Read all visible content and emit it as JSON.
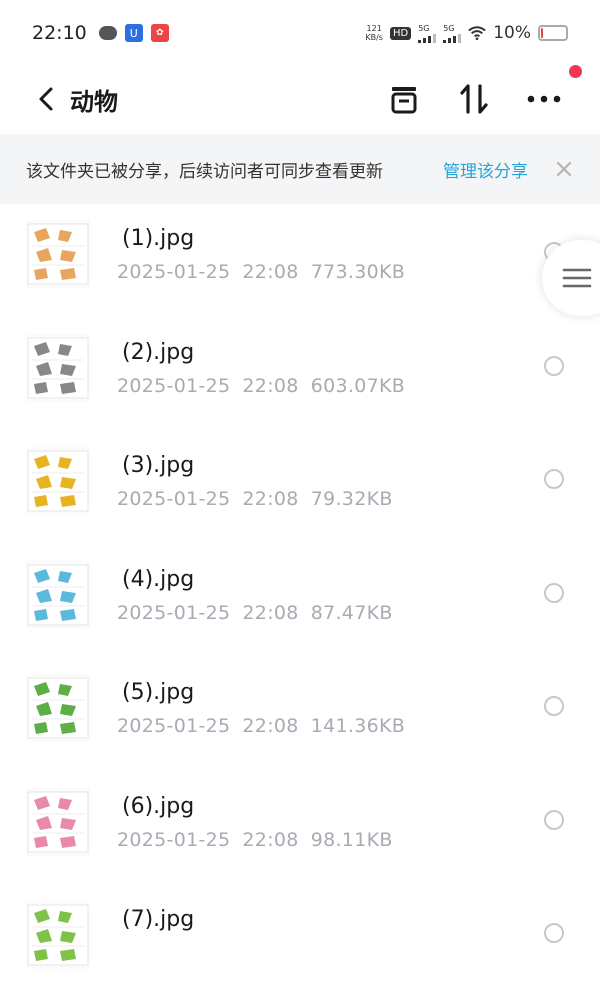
{
  "status_bar": {
    "time": "22:10",
    "net_speed_value": "121",
    "net_speed_unit": "KB/s",
    "hd_label": "HD",
    "sim1_label": "5G",
    "sim2_label": "5G",
    "battery_percent": "10%",
    "battery_level": 0.1,
    "battery_color": "#e74545"
  },
  "nav": {
    "title": "动物"
  },
  "share_banner": {
    "text": "该文件夹已被分享，后续访问者可同步查看更新",
    "manage_label": "管理该分享"
  },
  "accent_color": "#2aa3d8",
  "files": [
    {
      "name": "(1).jpg",
      "date": "2025-01-25",
      "time": "22:08",
      "size": "773.30KB",
      "thumb_color": "#e8a560"
    },
    {
      "name": "(2).jpg",
      "date": "2025-01-25",
      "time": "22:08",
      "size": "603.07KB",
      "thumb_color": "#888888"
    },
    {
      "name": "(3).jpg",
      "date": "2025-01-25",
      "time": "22:08",
      "size": "79.32KB",
      "thumb_color": "#e6b422"
    },
    {
      "name": "(4).jpg",
      "date": "2025-01-25",
      "time": "22:08",
      "size": "87.47KB",
      "thumb_color": "#5bb9db"
    },
    {
      "name": "(5).jpg",
      "date": "2025-01-25",
      "time": "22:08",
      "size": "141.36KB",
      "thumb_color": "#5cae45"
    },
    {
      "name": "(6).jpg",
      "date": "2025-01-25",
      "time": "22:08",
      "size": "98.11KB",
      "thumb_color": "#e98aa6"
    },
    {
      "name": "(7).jpg",
      "date": "",
      "time": "",
      "size": "",
      "thumb_color": "#7ec24a"
    }
  ]
}
